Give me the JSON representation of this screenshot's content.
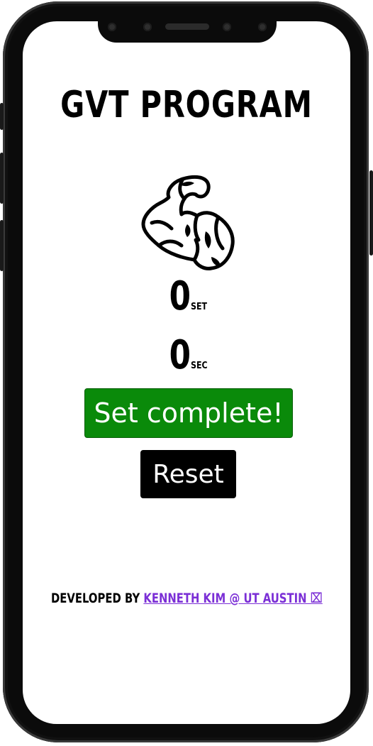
{
  "app": {
    "title": "GVT PROGRAM"
  },
  "counters": {
    "set_value": "0",
    "set_unit": "SET",
    "sec_value": "0",
    "sec_unit": "SEC"
  },
  "buttons": {
    "complete_label": "Set complete!",
    "reset_label": "Reset"
  },
  "footer": {
    "prefix": "DEVELOPED BY",
    "link_text": "KENNETH KIM @ UT AUSTIN ⌧"
  },
  "colors": {
    "complete_button": "#0a8a0a",
    "reset_button": "#000000",
    "link": "#7b2fd6"
  },
  "icons": {
    "hero": "flexed-biceps-icon"
  }
}
